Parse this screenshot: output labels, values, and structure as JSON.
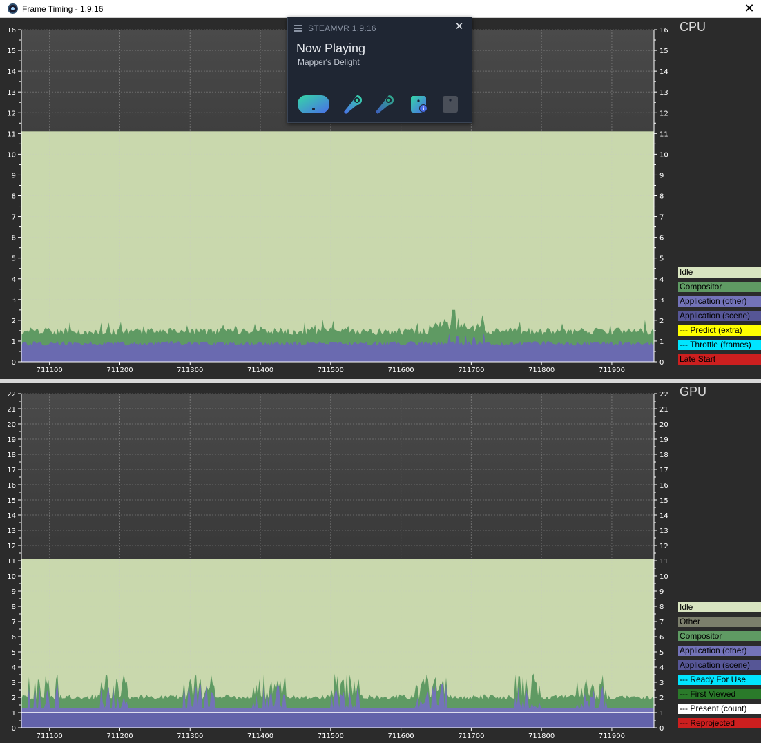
{
  "window": {
    "title": "Frame Timing - 1.9.16",
    "close_glyph": "✕"
  },
  "steamvr": {
    "brand": "STEAMVR 1.9.16",
    "minimize_glyph": "–",
    "close_glyph": "✕",
    "now_playing": "Now Playing",
    "game": "Mapper's Delight",
    "devices": [
      "headset-icon",
      "controller-left-icon",
      "controller-right-icon",
      "base-station-info-icon",
      "base-station-icon"
    ]
  },
  "cpu": {
    "heading": "CPU",
    "legend": [
      {
        "label": "Idle",
        "bg": "#d8e4c0",
        "fg": "#000000"
      },
      {
        "label": "Compositor",
        "bg": "#5f9a63",
        "fg": "#000000"
      },
      {
        "label": "Application (other)",
        "bg": "#7373b8",
        "fg": "#000000"
      },
      {
        "label": "Application (scene)",
        "bg": "#565696",
        "fg": "#000000"
      },
      {
        "label": "--- Predict (extra)",
        "bg": "#ffff00",
        "fg": "#000000"
      },
      {
        "label": "--- Throttle (frames)",
        "bg": "#00e5ff",
        "fg": "#000000"
      },
      {
        "label": "Late Start",
        "bg": "#cc1f1f",
        "fg": "#000000"
      }
    ]
  },
  "gpu": {
    "heading": "GPU",
    "legend": [
      {
        "label": "Idle",
        "bg": "#d8e4c0",
        "fg": "#000000"
      },
      {
        "label": "Other",
        "bg": "#7c7f6c",
        "fg": "#000000"
      },
      {
        "label": "Compositor",
        "bg": "#5f9a63",
        "fg": "#000000"
      },
      {
        "label": "Application (other)",
        "bg": "#7373b8",
        "fg": "#000000"
      },
      {
        "label": "Application (scene)",
        "bg": "#565696",
        "fg": "#000000"
      },
      {
        "label": "--- Ready For Use",
        "bg": "#00e5ff",
        "fg": "#000000"
      },
      {
        "label": "--- First Viewed",
        "bg": "#2a7a2a",
        "fg": "#000000"
      },
      {
        "label": "--- Present (count)",
        "bg": "#ffffff",
        "fg": "#000000"
      },
      {
        "label": "--- Reprojected",
        "bg": "#cc1f1f",
        "fg": "#000000"
      }
    ]
  },
  "chart_data": [
    {
      "type": "area",
      "title": "CPU",
      "x_ticks": [
        "711100",
        "711200",
        "711300",
        "711400",
        "711500",
        "711600",
        "711700",
        "711800",
        "711900"
      ],
      "xlim": [
        711060,
        711960
      ],
      "y_ticks": [
        0,
        1,
        2,
        3,
        4,
        5,
        6,
        7,
        8,
        9,
        10,
        11,
        12,
        13,
        14,
        15,
        16
      ],
      "ylim": [
        0,
        16
      ],
      "grid": true,
      "idle_level": 11.1,
      "series": [
        {
          "name": "Idle",
          "color": "#c9d8ad",
          "values_note": "constant fill up to",
          "level": 11.1
        },
        {
          "name": "Application (scene)",
          "color": "#565696",
          "baseline": 0.85,
          "typical_range": [
            0.75,
            1.0
          ]
        },
        {
          "name": "Compositor",
          "color": "#5f9a63",
          "baseline": 1.45,
          "typical_range": [
            1.2,
            1.9
          ],
          "peak": {
            "x": 711675,
            "value": 2.5
          }
        }
      ]
    },
    {
      "type": "area",
      "title": "GPU",
      "x_ticks": [
        "711100",
        "711200",
        "711300",
        "711400",
        "711500",
        "711600",
        "711700",
        "711800",
        "711900"
      ],
      "xlim": [
        711060,
        711960
      ],
      "y_ticks": [
        0,
        1,
        2,
        3,
        4,
        5,
        6,
        7,
        8,
        9,
        10,
        11,
        12,
        13,
        14,
        15,
        16,
        17,
        18,
        19,
        20,
        21,
        22
      ],
      "ylim": [
        0,
        22
      ],
      "grid": true,
      "idle_level": 11.1,
      "series": [
        {
          "name": "Idle",
          "color": "#c9d8ad",
          "level": 11.1
        },
        {
          "name": "Application (scene)",
          "color": "#565696",
          "baseline": 1.0
        },
        {
          "name": "Application (other)",
          "color": "#7373b8",
          "baseline": 1.3
        },
        {
          "name": "Compositor",
          "color": "#5f9a63",
          "baseline": 2.0,
          "typical_range": [
            1.8,
            2.3
          ]
        },
        {
          "name": "--- Present (count)",
          "color": "#ffffff",
          "level": 1.0
        }
      ],
      "spike_bursts_x": [
        711070,
        711165,
        711290,
        711390,
        711500,
        711620,
        711760,
        711850
      ],
      "spike_peak": 3.6
    }
  ]
}
